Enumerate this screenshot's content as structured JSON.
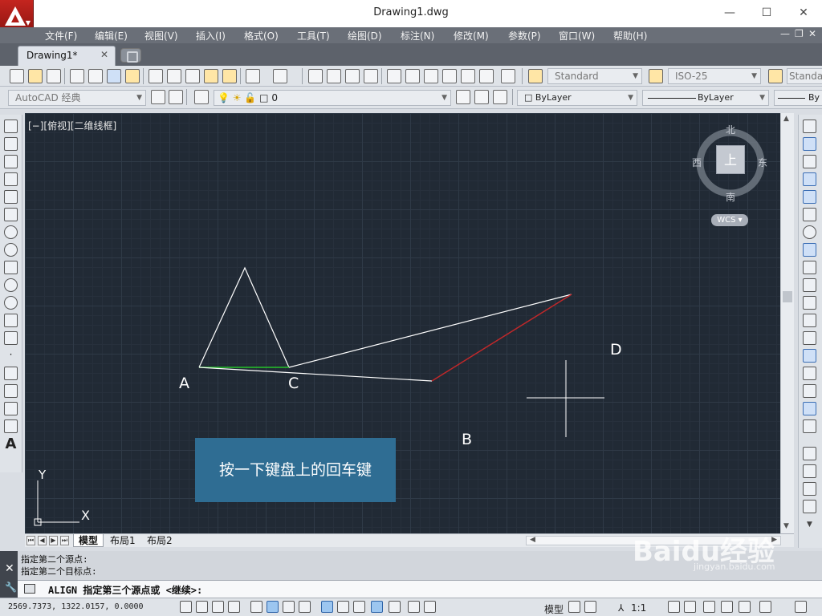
{
  "window": {
    "title": "Drawing1.dwg",
    "controls": [
      "—",
      "☐",
      "✕"
    ]
  },
  "menu": {
    "items": [
      "文件(F)",
      "编辑(E)",
      "视图(V)",
      "插入(I)",
      "格式(O)",
      "工具(T)",
      "绘图(D)",
      "标注(N)",
      "修改(M)",
      "参数(P)",
      "窗口(W)",
      "帮助(H)"
    ]
  },
  "tabs": {
    "document": "Drawing1*",
    "close": "✕"
  },
  "toolbar": {
    "text_style": "Standard",
    "dim_style": "ISO-25",
    "table_style": "Standa",
    "workspace": "AutoCAD 经典",
    "layer": "0",
    "color": "ByLayer",
    "linetype": "ByLayer",
    "lineweight": "By"
  },
  "canvas": {
    "view_label": "[−][俯视][二维线框]",
    "compass": {
      "north": "北",
      "south": "南",
      "east": "东",
      "west": "西",
      "top": "上"
    },
    "wcs": "WCS ▾",
    "points": {
      "A": "A",
      "B": "B",
      "C": "C",
      "D": "D"
    },
    "axis": {
      "x": "X",
      "y": "Y"
    },
    "callout": "按一下键盘上的回车键",
    "line_colors": {
      "white": "#ffffff",
      "red": "#c0282a",
      "green": "#26c22a"
    }
  },
  "layout_tabs": [
    "模型",
    "布局1",
    "布局2"
  ],
  "command": {
    "history": [
      "指定第二个源点:",
      "指定第二个目标点:"
    ],
    "prompt": "ALIGN 指定第三个源点或 <继续>:"
  },
  "status": {
    "coords": "2569.7373, 1322.0157, 0.0000",
    "model": "模型",
    "scale": "1:1"
  },
  "watermark": {
    "main": "Baidu经验",
    "url": "jingyan.baidu.com"
  }
}
